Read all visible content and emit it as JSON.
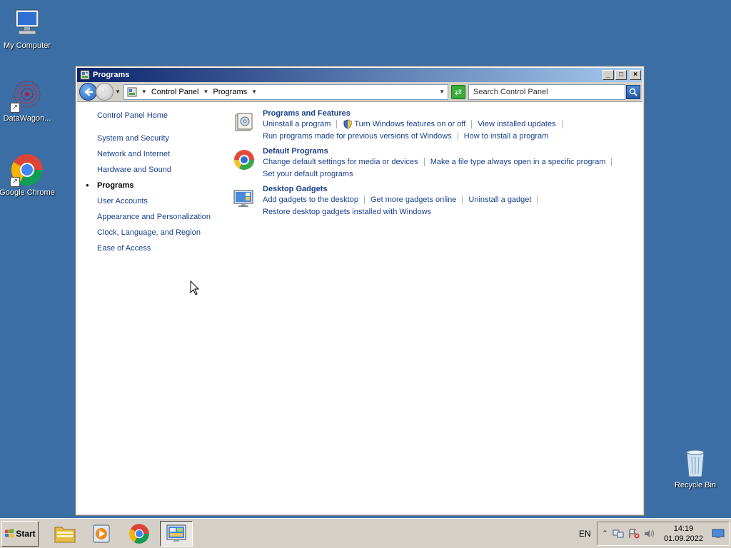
{
  "desktop": {
    "icons": [
      {
        "label": "My Computer",
        "icon": "computer-icon"
      },
      {
        "label": "DataWagon...",
        "icon": "datawagon-icon"
      },
      {
        "label": "Google Chrome",
        "icon": "chrome-icon"
      },
      {
        "label": "Recycle Bin",
        "icon": "recycle-bin-icon"
      }
    ]
  },
  "window": {
    "title": "Programs",
    "breadcrumb": [
      "Control Panel",
      "Programs"
    ],
    "search_placeholder": "Search Control Panel"
  },
  "left_nav": {
    "home": "Control Panel Home",
    "items": [
      {
        "label": "System and Security",
        "active": false
      },
      {
        "label": "Network and Internet",
        "active": false
      },
      {
        "label": "Hardware and Sound",
        "active": false
      },
      {
        "label": "Programs",
        "active": true
      },
      {
        "label": "User Accounts",
        "active": false
      },
      {
        "label": "Appearance and Personalization",
        "active": false
      },
      {
        "label": "Clock, Language, and Region",
        "active": false
      },
      {
        "label": "Ease of Access",
        "active": false
      }
    ]
  },
  "sections": [
    {
      "title": "Programs and Features",
      "icon": "programs-features-icon",
      "links": [
        "Uninstall a program",
        "Turn Windows features on or off",
        "View installed updates",
        "Run programs made for previous versions of Windows",
        "How to install a program"
      ]
    },
    {
      "title": "Default Programs",
      "icon": "default-programs-icon",
      "links": [
        "Change default settings for media or devices",
        "Make a file type always open in a specific program",
        "Set your default programs"
      ]
    },
    {
      "title": "Desktop Gadgets",
      "icon": "desktop-gadgets-icon",
      "links": [
        "Add gadgets to the desktop",
        "Get more gadgets online",
        "Uninstall a gadget",
        "Restore desktop gadgets installed with Windows"
      ]
    }
  ],
  "taskbar": {
    "start_label": "Start",
    "language": "EN",
    "time": "14:19",
    "date": "01.09.2022"
  },
  "colors": {
    "desktop": "#3a6ea5",
    "link": "#1b3f8b",
    "titlebar_start": "#0a246a",
    "titlebar_end": "#a6caf0"
  }
}
